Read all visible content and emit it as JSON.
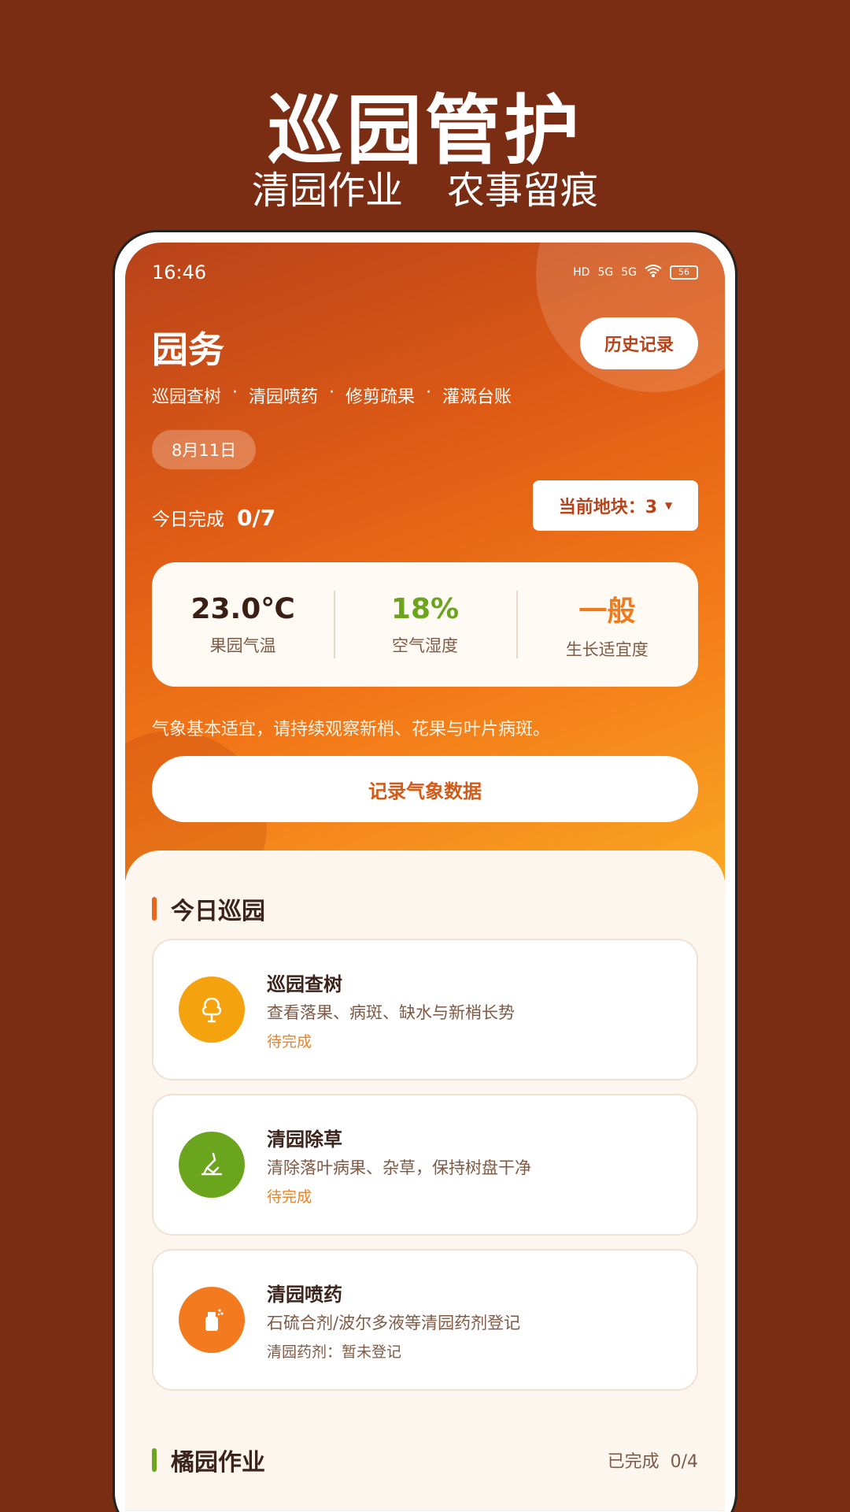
{
  "promo": {
    "title": "巡园管护",
    "subtitle_left": "清园作业",
    "subtitle_right": "农事留痕"
  },
  "status_bar": {
    "time": "16:46",
    "battery": "56",
    "network": "5G"
  },
  "header": {
    "title": "园务",
    "history_button": "历史记录",
    "modules": [
      "巡园查树",
      "清园喷药",
      "修剪疏果",
      "灌溉台账"
    ],
    "separator": "·",
    "date": "8月11日",
    "complete_label": "今日完成",
    "complete_count": "0/7",
    "plot_select": "当前地块：3"
  },
  "weather": {
    "temperature": {
      "value": "23.0℃",
      "label": "果园气温",
      "color": "#3b1f14"
    },
    "humidity": {
      "value": "18%",
      "label": "空气湿度",
      "color": "#6aa51d"
    },
    "suitability": {
      "value": "一般",
      "label": "生长适宜度",
      "color": "#ef7a1a"
    },
    "advice": "气象基本适宜，请持续观察新梢、花果与叶片病斑。",
    "record_button": "记录气象数据"
  },
  "today_patrol": {
    "title": "今日巡园",
    "accent": "#e8671b",
    "tasks": [
      {
        "title": "巡园查树",
        "desc": "查看落果、病斑、缺水与新梢长势",
        "status": "待完成",
        "icon": "tree-icon",
        "color": "#f5a20f"
      },
      {
        "title": "清园除草",
        "desc": "清除落叶病果、杂草，保持树盘干净",
        "status": "待完成",
        "icon": "weeding-icon",
        "color": "#6aa51d"
      },
      {
        "title": "清园喷药",
        "desc": "石硫合剂/波尔多液等清园药剂登记",
        "status": "清园药剂：暂未登记",
        "icon": "spray-icon",
        "color": "#f47a20"
      }
    ]
  },
  "orchard_work": {
    "title": "橘园作业",
    "accent": "#6aa51d",
    "done_summary": "已完成  0/4"
  }
}
